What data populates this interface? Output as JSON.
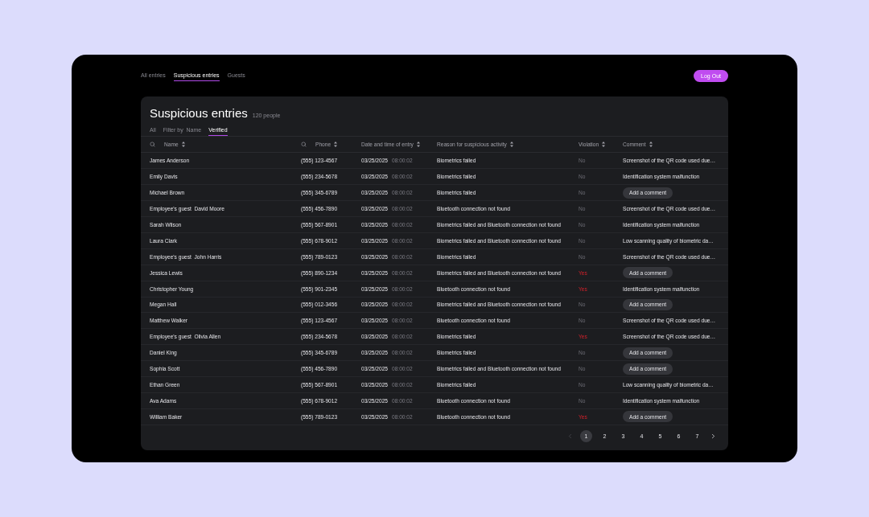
{
  "nav_tabs": [
    {
      "label": "All entries",
      "selected": false
    },
    {
      "label": "Suspicious entries",
      "selected": true
    },
    {
      "label": "Guests",
      "selected": false
    }
  ],
  "logout_button": "Log Out",
  "title": "Suspicious entries",
  "count": "120 people",
  "filters": [
    {
      "label": "All",
      "selected": false
    },
    {
      "label": "Filter by  Name",
      "selected": false
    },
    {
      "label": "Verified",
      "selected": true
    }
  ],
  "columns": [
    {
      "label": "Name",
      "search": true
    },
    {
      "label": "Phone",
      "search": true
    },
    {
      "label": "Date and time of entry",
      "search": false
    },
    {
      "label": "Reason for suspicious activity",
      "search": false
    },
    {
      "label": "Violation",
      "search": false
    },
    {
      "label": "Comment",
      "search": false
    }
  ],
  "rows": [
    {
      "name": "James Anderson",
      "phone": "(555) 123-4567",
      "date": "03/25/2025",
      "time": "08:00:02",
      "reason": "Biometrics failed",
      "violation": "No",
      "flagged": false,
      "comment": {
        "kind": "text",
        "text": "Screenshot of the QR code used due…"
      }
    },
    {
      "name": "Emily Davis",
      "phone": "(555) 234-5678",
      "date": "03/25/2025",
      "time": "08:00:02",
      "reason": "Biometrics failed",
      "violation": "No",
      "flagged": false,
      "comment": {
        "kind": "text",
        "text": "Identification system malfunction"
      }
    },
    {
      "name": "Michael Brown",
      "phone": "(555) 345-6789",
      "date": "03/25/2025",
      "time": "08:00:02",
      "reason": "Biometrics failed",
      "violation": "No",
      "flagged": false,
      "comment": {
        "kind": "button",
        "text": "Add a comment"
      }
    },
    {
      "name": "Employee's guest  David Moore",
      "phone": "(555) 456-7890",
      "date": "03/25/2025",
      "time": "08:00:02",
      "reason": "Bluetooth connection not found",
      "violation": "No",
      "flagged": false,
      "comment": {
        "kind": "text",
        "text": "Screenshot of the QR code used due…"
      }
    },
    {
      "name": "Sarah Wilson",
      "phone": "(555) 567-8901",
      "date": "03/25/2025",
      "time": "08:00:02",
      "reason": "Biometrics failed and Bluetooth connection not found",
      "violation": "No",
      "flagged": false,
      "comment": {
        "kind": "text",
        "text": "Identification system malfunction"
      }
    },
    {
      "name": "Laura Clark",
      "phone": "(555) 678-9012",
      "date": "03/25/2025",
      "time": "08:00:02",
      "reason": "Biometrics failed and Bluetooth connection not found",
      "violation": "No",
      "flagged": false,
      "comment": {
        "kind": "text",
        "text": "Low scanning quality of biometric da…"
      }
    },
    {
      "name": "Employee's guest  John Harris",
      "phone": "(555) 789-0123",
      "date": "03/25/2025",
      "time": "08:00:02",
      "reason": "Biometrics failed",
      "violation": "No",
      "flagged": false,
      "comment": {
        "kind": "text",
        "text": "Screenshot of the QR code used due…"
      }
    },
    {
      "name": "Jessica Lewis",
      "phone": "(555) 890-1234",
      "date": "03/25/2025",
      "time": "08:00:02",
      "reason": "Biometrics failed and Bluetooth connection not found",
      "violation": "Yes",
      "flagged": true,
      "comment": {
        "kind": "button",
        "text": "Add a comment"
      }
    },
    {
      "name": "Christopher Young",
      "phone": "(555) 901-2345",
      "date": "03/25/2025",
      "time": "08:00:02",
      "reason": "Bluetooth connection not found",
      "violation": "Yes",
      "flagged": true,
      "comment": {
        "kind": "text",
        "text": "Identification system malfunction"
      }
    },
    {
      "name": "Megan Hall",
      "phone": "(555) 012-3456",
      "date": "03/25/2025",
      "time": "08:00:02",
      "reason": "Biometrics failed and Bluetooth connection not found",
      "violation": "No",
      "flagged": false,
      "comment": {
        "kind": "button",
        "text": "Add a comment"
      }
    },
    {
      "name": "Matthew Walker",
      "phone": "(555) 123-4567",
      "date": "03/25/2025",
      "time": "08:00:02",
      "reason": "Bluetooth connection not found",
      "violation": "No",
      "flagged": false,
      "comment": {
        "kind": "text",
        "text": "Screenshot of the QR code used due…"
      }
    },
    {
      "name": "Employee's guest  Olivia Allen",
      "phone": "(555) 234-5678",
      "date": "03/25/2025",
      "time": "08:00:02",
      "reason": "Biometrics failed",
      "violation": "Yes",
      "flagged": true,
      "comment": {
        "kind": "text",
        "text": "Screenshot of the QR code used due…"
      }
    },
    {
      "name": "Daniel King",
      "phone": "(555) 345-6789",
      "date": "03/25/2025",
      "time": "08:00:02",
      "reason": "Biometrics failed",
      "violation": "No",
      "flagged": false,
      "comment": {
        "kind": "button",
        "text": "Add a comment"
      }
    },
    {
      "name": "Sophia Scott",
      "phone": "(555) 456-7890",
      "date": "03/25/2025",
      "time": "08:00:02",
      "reason": "Biometrics failed and Bluetooth connection not found",
      "violation": "No",
      "flagged": false,
      "comment": {
        "kind": "button",
        "text": "Add a comment"
      }
    },
    {
      "name": "Ethan Green",
      "phone": "(555) 567-8901",
      "date": "03/25/2025",
      "time": "08:00:02",
      "reason": "Biometrics failed",
      "violation": "No",
      "flagged": false,
      "comment": {
        "kind": "text",
        "text": "Low scanning quality of biometric da…"
      }
    },
    {
      "name": "Ava Adams",
      "phone": "(555) 678-9012",
      "date": "03/25/2025",
      "time": "08:00:02",
      "reason": "Bluetooth connection not found",
      "violation": "No",
      "flagged": false,
      "comment": {
        "kind": "text",
        "text": "Identification system malfunction"
      }
    },
    {
      "name": "William Baker",
      "phone": "(555) 789-0123",
      "date": "03/25/2025",
      "time": "08:00:02",
      "reason": "Bluetooth connection not found",
      "violation": "Yes",
      "flagged": true,
      "comment": {
        "kind": "button",
        "text": "Add a comment"
      }
    }
  ],
  "pagination": {
    "prev_disabled": true,
    "pages": [
      {
        "label": "1",
        "selected": true
      },
      {
        "label": "2",
        "selected": false
      },
      {
        "label": "3",
        "selected": false
      },
      {
        "label": "4",
        "selected": false
      },
      {
        "label": "5",
        "selected": false
      },
      {
        "label": "6",
        "selected": false
      },
      {
        "label": "7",
        "selected": false
      }
    ]
  }
}
